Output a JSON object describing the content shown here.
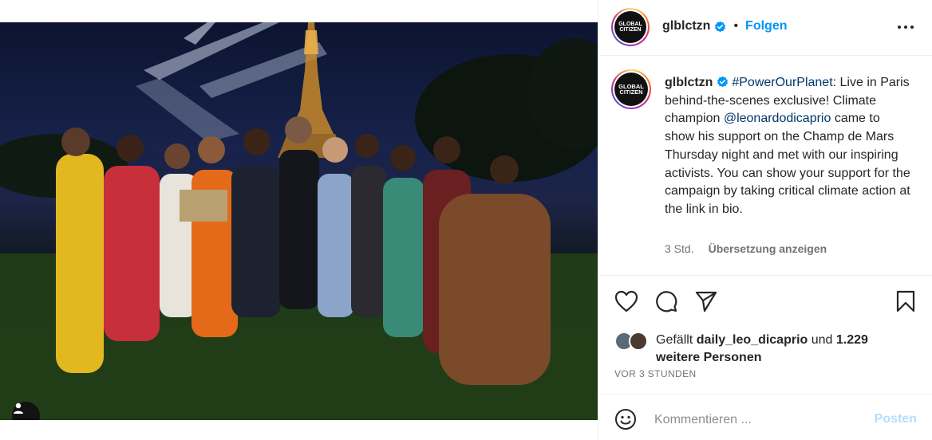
{
  "post": {
    "author": "glblctzn",
    "verified": true,
    "follow_label": "Folgen",
    "logo_line1": "GLOBAL",
    "logo_line2": "CITIZEN"
  },
  "caption": {
    "username": "glblctzn",
    "hashtag": "#PowerOurPlanet",
    "text_part1": ": Live in Paris behind-the-scenes exclusive! Climate champion ",
    "mention": "@leonardodicaprio",
    "text_part2": " came to show his support on the Champ de Mars Thursday night and met with our inspiring activists. You can show your support for the campaign by taking critical climate action at the link in bio.",
    "time": "3 Std.",
    "translate_label": "Übersetzung anzeigen"
  },
  "actions": {
    "like_icon": "heart-icon",
    "comment_icon": "comment-icon",
    "share_icon": "paper-plane-icon",
    "save_icon": "bookmark-icon"
  },
  "likes": {
    "prefix": "Gefällt ",
    "liker": "daily_leo_dicaprio",
    "middle": " und ",
    "count": "1.229",
    "suffix_line2": "weitere Personen"
  },
  "timestamp": "VOR 3 STUNDEN",
  "comment_box": {
    "placeholder": "Kommentieren ...",
    "post_label": "Posten"
  },
  "colors": {
    "accent_blue": "#0095f6",
    "mention_link": "#00376b",
    "disabled_post": "#b2dffc",
    "secondary_text": "#737373"
  }
}
